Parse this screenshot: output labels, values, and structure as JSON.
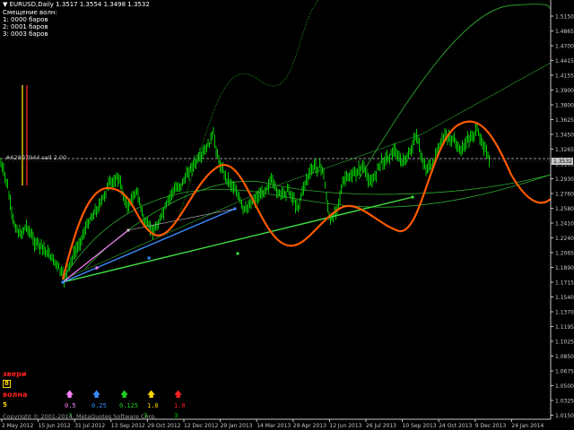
{
  "header": {
    "symbol_line": "EURUSD,Daily  1.3517 1.3554 1.3498 1.3532",
    "shift_title": "Смещение волн:",
    "shift_lines": [
      "1: 0000 баров",
      "2: 0001 баров",
      "3: 0003 баров"
    ]
  },
  "order_line": {
    "label": "#62807944 sell 2.00",
    "price": 1.3532,
    "color": "#c8c8c8"
  },
  "current_price_label": "1.3532",
  "price_axis": {
    "labels": [
      "1.5150",
      "1.4865",
      "1.4700",
      "1.4415",
      "1.4155",
      "1.3900",
      "1.3800",
      "1.3625",
      "1.3450",
      "1.3265",
      "1.3105",
      "1.2930",
      "1.2760",
      "1.2580",
      "1.2410",
      "1.2240",
      "1.2065",
      "1.1890",
      "1.1715",
      "1.1540",
      "1.1370",
      "1.1195",
      "1.1025",
      "1.0850",
      "1.0675",
      "1.0500",
      "1.0325",
      "1.0150"
    ]
  },
  "time_axis": {
    "labels": [
      "2 May 2012",
      "15 Jun 2012",
      "31 Jul 2012",
      "13 Sep 2012",
      "29 Oct 2012",
      "12 Dec 2012",
      "29 Jan 2013",
      "14 Mar 2013",
      "29 Apr 2013",
      "12 Jun 2013",
      "26 Jul 2013",
      "10 Sep 2013",
      "24 Oct 2013",
      "9 Dec 2013",
      "24 Jan 2014"
    ]
  },
  "indicator": {
    "label_top": "звери",
    "label_wave": "волна",
    "value_top": "8",
    "value_wave": "5",
    "params": [
      {
        "value": "0.5",
        "color": "#ff80ff"
      },
      {
        "value": "0.25",
        "color": "#3a8cff"
      },
      {
        "value": "0.125",
        "color": "#20d020"
      },
      {
        "value": "1.0",
        "color": "#ffd700"
      },
      {
        "value": "1.0",
        "color": "#ff2020"
      }
    ],
    "counts": [
      "3",
      "3",
      "3"
    ]
  },
  "copyright": "Copyright © 2001-2014, MetaQuotes Software Corp.",
  "colors": {
    "candles": "#00c800",
    "wave": "#ff5a00",
    "trend_blue": "#3a8cff",
    "trend_pink": "#ff80ff",
    "trend_green": "#40e040",
    "vline_yellow": "#ffd700",
    "vline_red": "#ff2020"
  }
}
